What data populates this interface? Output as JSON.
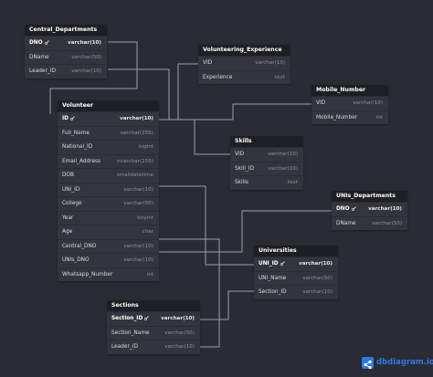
{
  "tables": [
    {
      "title": "Central_Departments",
      "rows": [
        {
          "name": "DNO",
          "type": "varchar(10)",
          "key": true
        },
        {
          "name": "DName",
          "type": "varchar(50)",
          "key": false
        },
        {
          "name": "Leader_ID",
          "type": "varchar(10)",
          "key": false
        }
      ]
    },
    {
      "title": "Volunteering_Experience",
      "rows": [
        {
          "name": "VID",
          "type": "varchar(10)",
          "key": false
        },
        {
          "name": "Experience",
          "type": "text",
          "key": false
        }
      ]
    },
    {
      "title": "Mobile_Number",
      "rows": [
        {
          "name": "VID",
          "type": "varchar(10)",
          "key": false
        },
        {
          "name": "Mobile_Number",
          "type": "int",
          "key": false
        }
      ]
    },
    {
      "title": "Volunteer",
      "rows": [
        {
          "name": "ID",
          "type": "varchar(10)",
          "key": true
        },
        {
          "name": "Full_Name",
          "type": "varchar(255)",
          "key": false
        },
        {
          "name": "National_ID",
          "type": "bigint",
          "key": false
        },
        {
          "name": "Email_Address",
          "type": "nvarchar(255)",
          "key": false
        },
        {
          "name": "DOB",
          "type": "smalldatetime",
          "key": false
        },
        {
          "name": "UNI_ID",
          "type": "varchar(10)",
          "key": false
        },
        {
          "name": "College",
          "type": "varchar(50)",
          "key": false
        },
        {
          "name": "Year",
          "type": "tinyint",
          "key": false
        },
        {
          "name": "Age",
          "type": "char",
          "key": false
        },
        {
          "name": "Central_DNO",
          "type": "varchar(10)",
          "key": false
        },
        {
          "name": "UNIs_DNO",
          "type": "varchar(10)",
          "key": false
        },
        {
          "name": "Whatsapp_Number",
          "type": "int",
          "key": false
        }
      ]
    },
    {
      "title": "Skills",
      "rows": [
        {
          "name": "VID",
          "type": "varchar(10)",
          "key": false
        },
        {
          "name": "Skill_ID",
          "type": "varchar(10)",
          "key": false
        },
        {
          "name": "Skills",
          "type": "text",
          "key": false
        }
      ]
    },
    {
      "title": "UNIs_Departments",
      "rows": [
        {
          "name": "DNO",
          "type": "varchar(10)",
          "key": true
        },
        {
          "name": "DName",
          "type": "varchar(50)",
          "key": false
        }
      ]
    },
    {
      "title": "Universities",
      "rows": [
        {
          "name": "UNI_ID",
          "type": "varchar(10)",
          "key": true
        },
        {
          "name": "UNI_Name",
          "type": "varchar(50)",
          "key": false
        },
        {
          "name": "Section_ID",
          "type": "varchar(10)",
          "key": false
        }
      ]
    },
    {
      "title": "Sections",
      "rows": [
        {
          "name": "Section_ID",
          "type": "varchar(10)",
          "key": true
        },
        {
          "name": "Section_Name",
          "type": "varchar(50)",
          "key": false
        },
        {
          "name": "Leader_ID",
          "type": "varchar(10)",
          "key": false
        }
      ]
    }
  ],
  "branding": {
    "logo_text": "dbdiagram.io"
  }
}
